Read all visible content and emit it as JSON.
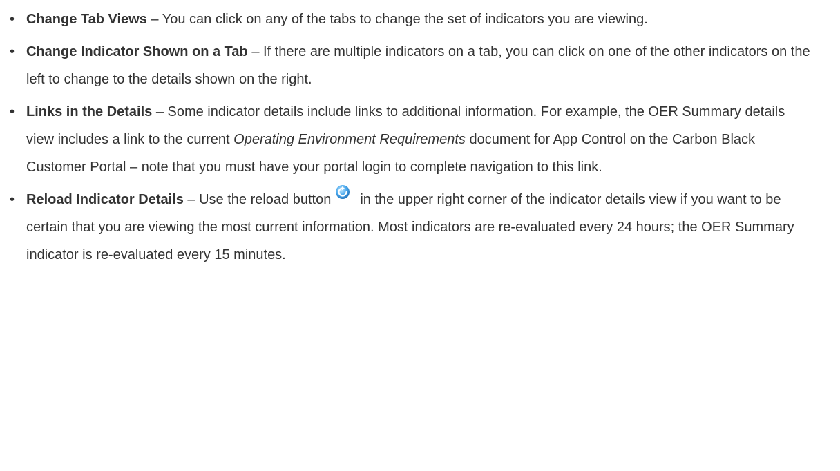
{
  "bullets": [
    {
      "label": "Change Tab Views",
      "text": " – You can click on any of the tabs to change the set of indicators you are viewing."
    },
    {
      "label": "Change Indicator Shown on a Tab",
      "text": " – If there are multiple indicators on a tab, you can click on one of the other indicators on the left to change to the details shown on the right."
    },
    {
      "label": "Links in the Details",
      "text_before": " – Some indicator details include links to additional information. For example, the OER Summary details view includes a link to the current ",
      "italic": "Operating Environment Requirements",
      "text_after": " document for App Control on the Carbon Black Customer Portal – note that you must have your portal login to complete navigation to this link."
    },
    {
      "label": "Reload Indicator Details",
      "text_before": " – Use the reload button",
      "icon": "reload-icon",
      "text_after": "in the upper right corner of the indicator details view if you want to be certain that you are viewing the most current information. Most indicators are re-evaluated every 24 hours; the OER Summary indicator is re-evaluated every 15 minutes."
    }
  ],
  "bullet_glyph": "•",
  "colors": {
    "text": "#333333",
    "icon_blue": "#2f8fdc",
    "icon_light": "#8fd0ff"
  }
}
